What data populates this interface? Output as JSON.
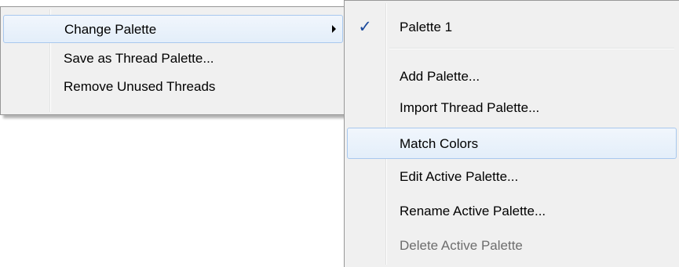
{
  "main_menu": {
    "items": [
      {
        "label": "Change Palette",
        "has_submenu": true,
        "highlighted": true
      },
      {
        "label": "Save as Thread Palette...",
        "has_submenu": false,
        "highlighted": false
      },
      {
        "label": "Remove Unused Threads",
        "has_submenu": false,
        "highlighted": false
      }
    ]
  },
  "submenu": {
    "checked_item": {
      "label": "Palette 1",
      "checked": true,
      "check_glyph": "✓"
    },
    "items": [
      {
        "label": "Add Palette...",
        "enabled": true,
        "highlighted": false
      },
      {
        "label": "Import Thread Palette...",
        "enabled": true,
        "highlighted": false
      },
      {
        "label": "Match Colors",
        "enabled": true,
        "highlighted": true
      },
      {
        "label": "Edit Active Palette...",
        "enabled": true,
        "highlighted": false
      },
      {
        "label": "Rename Active Palette...",
        "enabled": true,
        "highlighted": false
      },
      {
        "label": "Delete Active Palette",
        "enabled": false,
        "highlighted": false
      }
    ]
  },
  "colors": {
    "menu_background": "#f0f0f0",
    "menu_border": "#979797",
    "highlight_border": "#a8c8ee",
    "check_color": "#1c4a9c",
    "disabled_text": "#6d6d6d"
  }
}
